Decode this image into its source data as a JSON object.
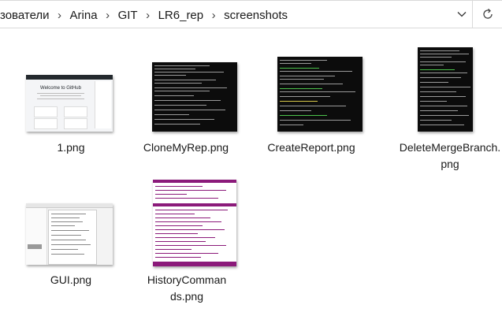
{
  "address": {
    "crumbs": [
      "зователи",
      "Arina",
      "GIT",
      "LR6_rep",
      "screenshots"
    ],
    "separator": "›"
  },
  "files": [
    {
      "name": "1.png"
    },
    {
      "name": "CloneMyRep.png"
    },
    {
      "name": "CreateReport.png"
    },
    {
      "name": "DeleteMergeBranch.png"
    },
    {
      "name": "GUI.png"
    },
    {
      "name": "HistoryCommands.png"
    }
  ],
  "thumbnails": {
    "welcome_title": "Welcome to GitHub"
  },
  "colors": {
    "terminal_bg": "#0c0c0c",
    "history_accent": "#8b1a7a",
    "text": "#1a1a1a"
  }
}
